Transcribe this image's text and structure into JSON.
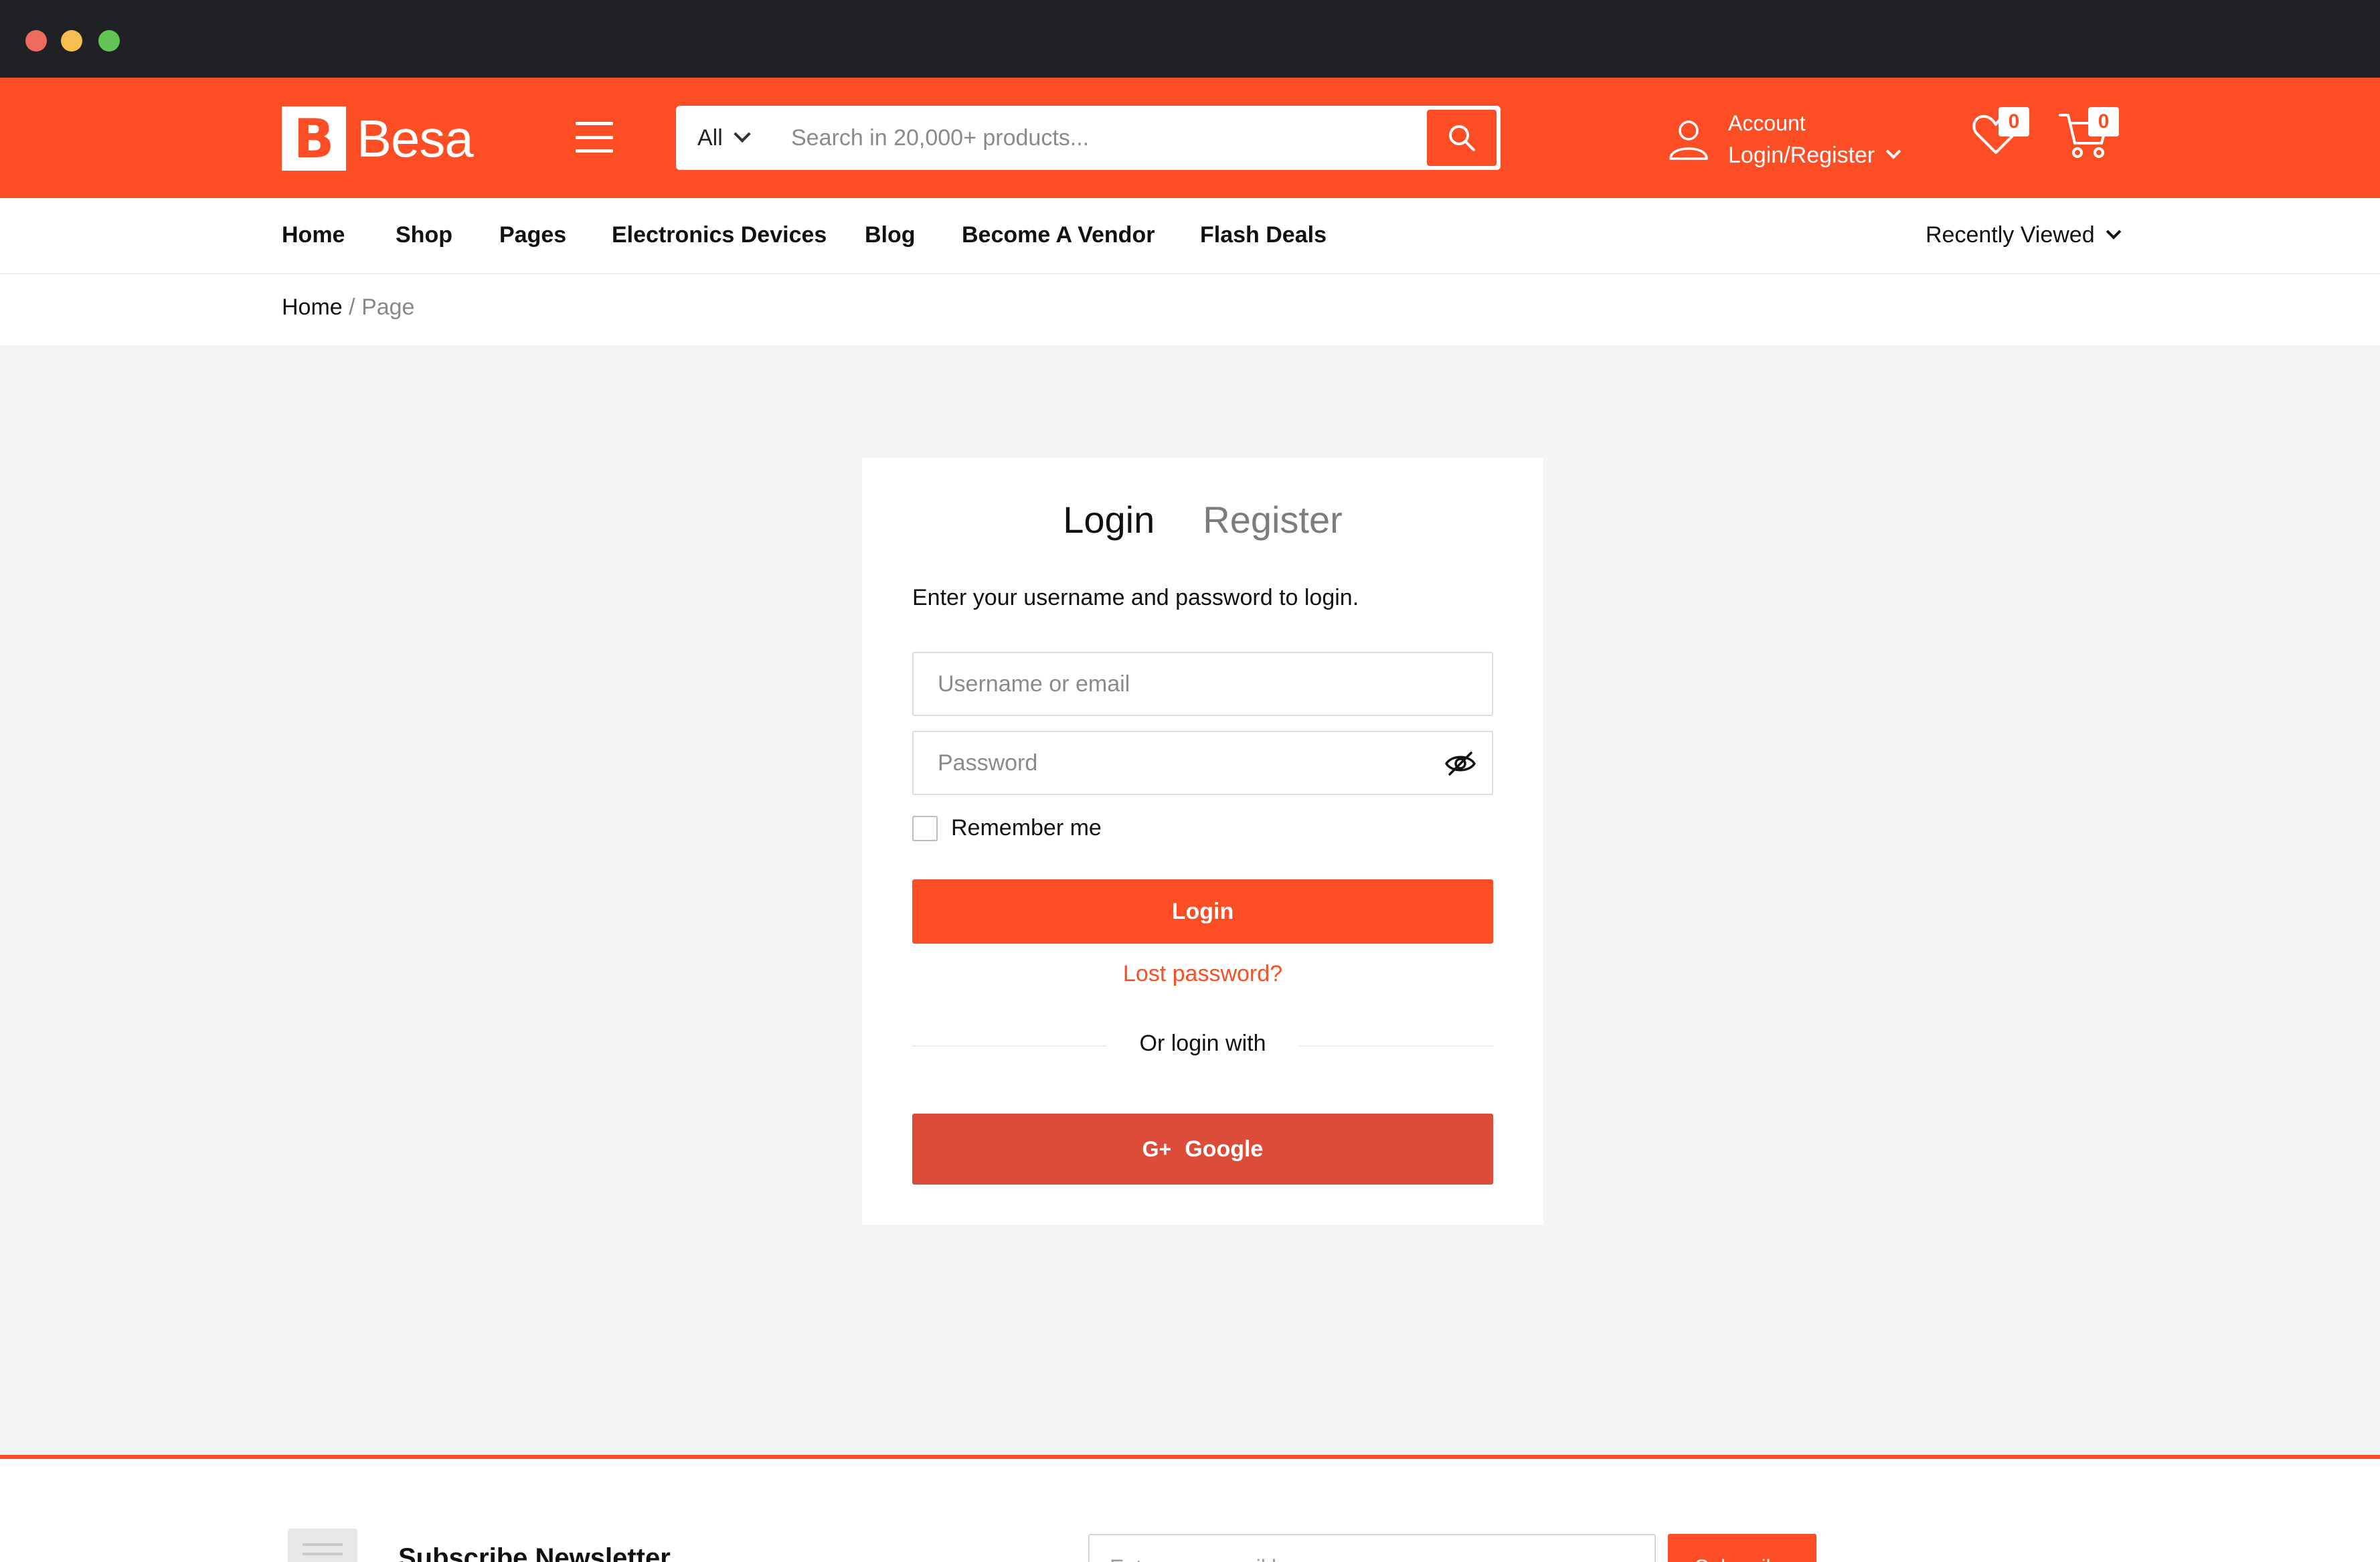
{
  "header": {
    "logo_letter": "B",
    "logo_text": "Besa",
    "search": {
      "category": "All",
      "placeholder": "Search in 20,000+ products..."
    },
    "account": {
      "line1": "Account",
      "line2": "Login/Register"
    },
    "wishlist_count": "0",
    "cart_count": "0"
  },
  "nav": {
    "items": [
      "Home",
      "Shop",
      "Pages",
      "Electronics Devices",
      "Blog",
      "Become A Vendor",
      "Flash Deals"
    ],
    "recently_viewed": "Recently Viewed"
  },
  "breadcrumb": {
    "home": "Home",
    "separator": "/",
    "current": "Page"
  },
  "login": {
    "tab_login": "Login",
    "tab_register": "Register",
    "intro": "Enter your username and password to login.",
    "username_placeholder": "Username or email",
    "password_placeholder": "Password",
    "remember_label": "Remember me",
    "remember_checked": false,
    "login_button": "Login",
    "lost_password": "Lost password?",
    "or_text": "Or login with",
    "google_icon_text": "G+",
    "google_button": "Google"
  },
  "footer": {
    "newsletter_title": "Subscribe Newsletter",
    "email_placeholder": "Enter your email here",
    "subscribe_button": "Subscribe"
  },
  "colors": {
    "brand": "#fc4d25",
    "google": "#dd4b39",
    "titlebar": "#202124"
  }
}
